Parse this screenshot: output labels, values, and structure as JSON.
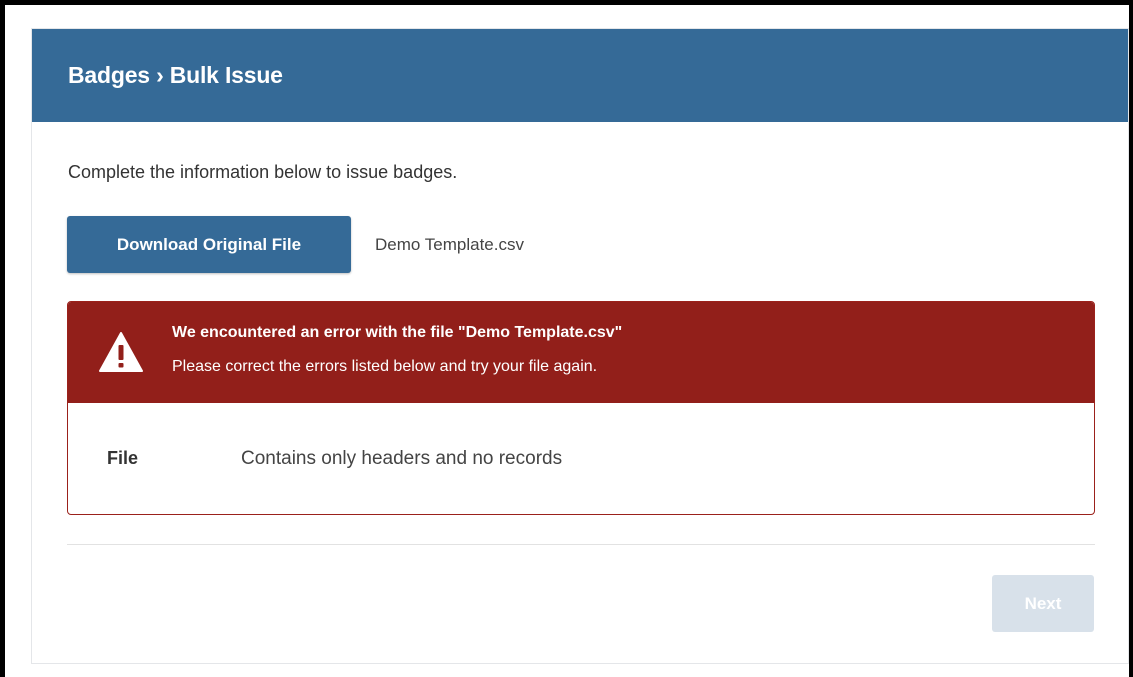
{
  "header": {
    "title": "Badges › Bulk Issue"
  },
  "main": {
    "intro": "Complete the information below to issue badges.",
    "download_button_label": "Download Original File",
    "filename": "Demo Template.csv",
    "error": {
      "icon": "warning-icon",
      "title": "We encountered an error with the file \"Demo Template.csv\"",
      "subtitle": "Please correct the errors listed below and try your file again.",
      "rows": [
        {
          "field": "File",
          "message": "Contains only headers and no records"
        }
      ]
    },
    "next_button_label": "Next",
    "next_button_state": "disabled"
  },
  "colors": {
    "header_bg": "#356a97",
    "primary_button": "#356a97",
    "error_header_bg": "#921f1a",
    "error_border": "#9b211b",
    "disabled_button": "#d8e1ea"
  }
}
